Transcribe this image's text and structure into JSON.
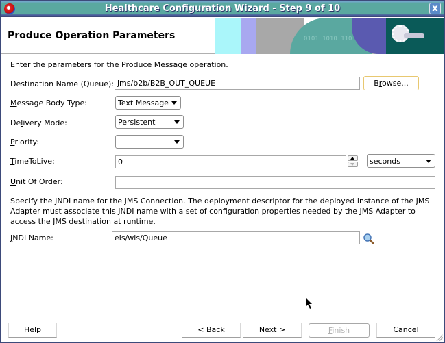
{
  "window": {
    "title": "Healthcare Configuration Wizard - Step 9 of 10",
    "close_label": "x"
  },
  "header": {
    "page_title": "Produce Operation Parameters",
    "banner_binary": "0101 1010 110"
  },
  "form": {
    "intro": "Enter the parameters for the Produce Message operation.",
    "destination": {
      "label": "Destination Name (Queue):",
      "value": "jms/b2b/B2B_OUT_QUEUE",
      "browse_label_pre": "B",
      "browse_label_mn": "r",
      "browse_label_post": "owse..."
    },
    "message_body_type": {
      "label_mn": "M",
      "label_rest": "essage Body Type:",
      "value": "Text Message"
    },
    "delivery_mode": {
      "label_pre": "De",
      "label_mn": "l",
      "label_rest": "ivery Mode:",
      "value": "Persistent"
    },
    "priority": {
      "label_mn": "P",
      "label_rest": "riority:",
      "value": ""
    },
    "time_to_live": {
      "label_mn": "T",
      "label_rest": "imeToLive:",
      "value": "0",
      "unit": "seconds"
    },
    "unit_of_order": {
      "label_mn": "U",
      "label_rest": "nit Of Order:",
      "value": ""
    },
    "jndi_description": "Specify the JNDI name for the JMS Connection.  The deployment descriptor for the deployed instance of the JMS Adapter must associate this JNDI name with a set of configuration properties needed by the JMS Adapter to access the JMS destination at runtime.",
    "jndi": {
      "label_mn": "J",
      "label_rest": "NDI Name:",
      "value": "eis/wls/Queue"
    }
  },
  "footer": {
    "help_mn": "H",
    "help_rest": "elp",
    "back_pre": "< ",
    "back_mn": "B",
    "back_rest": "ack",
    "next_mn": "N",
    "next_rest": "ext >",
    "finish_mn": "F",
    "finish_rest": "inish",
    "cancel": "Cancel"
  }
}
